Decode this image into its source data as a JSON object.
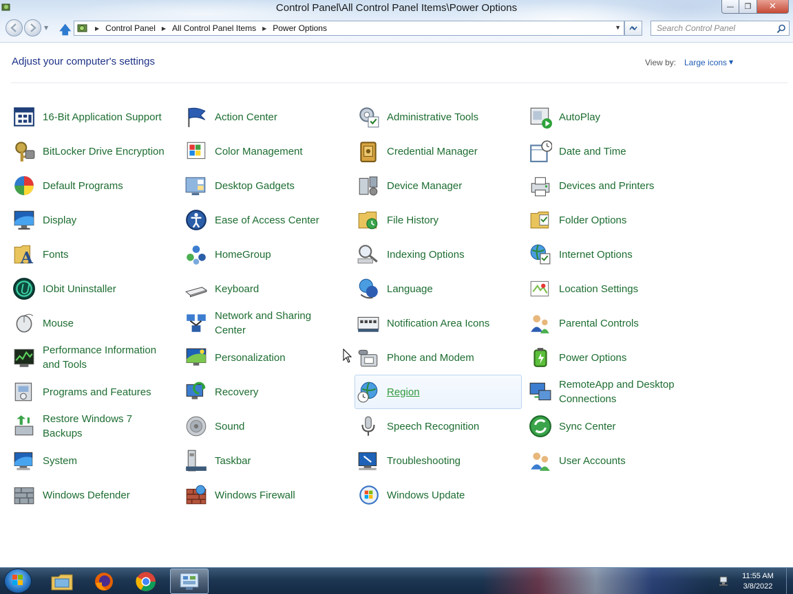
{
  "window": {
    "title": "Control Panel\\All Control Panel Items\\Power Options",
    "controls": {
      "minimize": "—",
      "maximize": "❐",
      "close": "✕"
    }
  },
  "address": {
    "crumbs": [
      "Control Panel",
      "All Control Panel Items",
      "Power Options"
    ],
    "search_placeholder": "Search Control Panel"
  },
  "main": {
    "heading": "Adjust your computer's settings",
    "view_by_label": "View by:",
    "view_by_value": "Large icons"
  },
  "items": [
    {
      "label": "16-Bit Application Support",
      "icon": "application-window-icon"
    },
    {
      "label": "Action Center",
      "icon": "flag-icon"
    },
    {
      "label": "Administrative Tools",
      "icon": "admin-tools-icon"
    },
    {
      "label": "AutoPlay",
      "icon": "autoplay-icon"
    },
    {
      "label": "BitLocker Drive Encryption",
      "icon": "key-lock-icon"
    },
    {
      "label": "Color Management",
      "icon": "color-management-icon"
    },
    {
      "label": "Credential Manager",
      "icon": "safe-icon"
    },
    {
      "label": "Date and Time",
      "icon": "calendar-clock-icon"
    },
    {
      "label": "Default Programs",
      "icon": "windows-orb-icon"
    },
    {
      "label": "Desktop Gadgets",
      "icon": "gadgets-icon"
    },
    {
      "label": "Device Manager",
      "icon": "device-manager-icon"
    },
    {
      "label": "Devices and Printers",
      "icon": "printer-icon"
    },
    {
      "label": "Display",
      "icon": "monitor-icon"
    },
    {
      "label": "Ease of Access Center",
      "icon": "ease-of-access-icon"
    },
    {
      "label": "File History",
      "icon": "file-history-icon"
    },
    {
      "label": "Folder Options",
      "icon": "folder-options-icon"
    },
    {
      "label": "Fonts",
      "icon": "fonts-folder-icon"
    },
    {
      "label": "HomeGroup",
      "icon": "homegroup-icon"
    },
    {
      "label": "Indexing Options",
      "icon": "indexing-icon"
    },
    {
      "label": "Internet Options",
      "icon": "globe-checklist-icon"
    },
    {
      "label": "IObit Uninstaller",
      "icon": "iobit-uninstaller-icon"
    },
    {
      "label": "Keyboard",
      "icon": "keyboard-icon"
    },
    {
      "label": "Language",
      "icon": "language-icon"
    },
    {
      "label": "Location Settings",
      "icon": "location-icon"
    },
    {
      "label": "Mouse",
      "icon": "mouse-icon"
    },
    {
      "label": "Network and Sharing Center",
      "icon": "network-icon"
    },
    {
      "label": "Notification Area Icons",
      "icon": "notification-area-icon"
    },
    {
      "label": "Parental Controls",
      "icon": "parental-controls-icon"
    },
    {
      "label": "Performance Information and Tools",
      "icon": "performance-icon"
    },
    {
      "label": "Personalization",
      "icon": "personalization-icon"
    },
    {
      "label": "Phone and Modem",
      "icon": "phone-modem-icon"
    },
    {
      "label": "Power Options",
      "icon": "battery-icon"
    },
    {
      "label": "Programs and Features",
      "icon": "programs-features-icon"
    },
    {
      "label": "Recovery",
      "icon": "recovery-icon"
    },
    {
      "label": "Region",
      "icon": "globe-clock-icon"
    },
    {
      "label": "RemoteApp and Desktop Connections",
      "icon": "remote-desktop-icon"
    },
    {
      "label": "Restore Windows 7 Backups",
      "icon": "backup-restore-icon"
    },
    {
      "label": "Sound",
      "icon": "speaker-icon"
    },
    {
      "label": "Speech Recognition",
      "icon": "microphone-icon"
    },
    {
      "label": "Sync Center",
      "icon": "sync-icon"
    },
    {
      "label": "System",
      "icon": "system-computer-icon"
    },
    {
      "label": "Taskbar",
      "icon": "taskbar-icon"
    },
    {
      "label": "Troubleshooting",
      "icon": "troubleshooting-icon"
    },
    {
      "label": "User Accounts",
      "icon": "users-icon"
    },
    {
      "label": "Windows Defender",
      "icon": "defender-wall-icon"
    },
    {
      "label": "Windows Firewall",
      "icon": "firewall-icon"
    },
    {
      "label": "Windows Update",
      "icon": "windows-update-icon"
    }
  ],
  "hovered_item": "Region",
  "taskbar": {
    "apps": [
      "file-explorer-icon",
      "firefox-icon",
      "chrome-icon",
      "control-panel-icon"
    ],
    "active_app": "control-panel-icon",
    "time": "11:55 AM",
    "date": "3/8/2022"
  },
  "colors": {
    "link_green": "#1d6d31",
    "heading_blue": "#1e3287",
    "accent_blue": "#1e5bb5"
  }
}
